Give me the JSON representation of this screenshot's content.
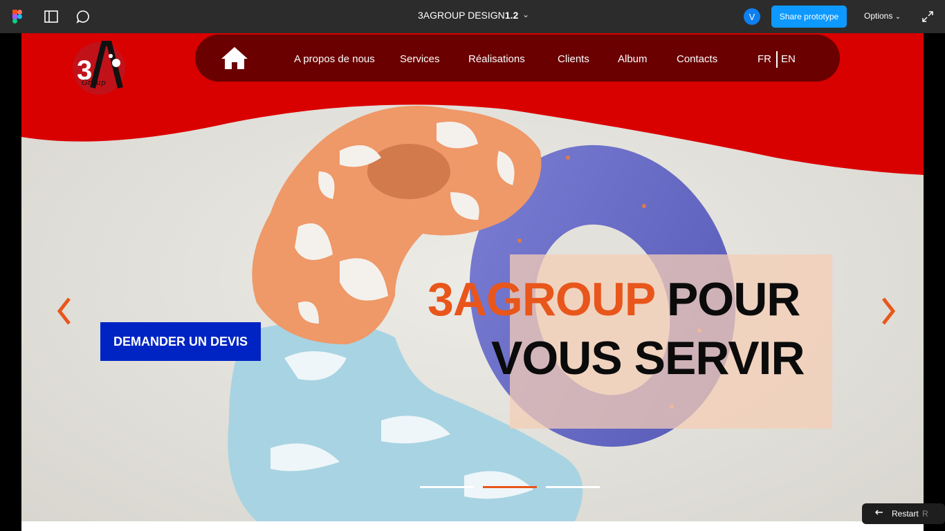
{
  "topbar": {
    "title_prefix": "3AGROUP DESIGN",
    "title_version": "1.2",
    "avatar_initial": "V",
    "share_label": "Share prototype",
    "options_label": "Options"
  },
  "site": {
    "logo_alt": "3A Group",
    "nav": {
      "items": [
        "A propos de nous",
        "Services",
        "Réalisations",
        "Clients",
        "Album",
        "Contacts"
      ],
      "lang_fr": "FR",
      "lang_en": "EN"
    },
    "hero": {
      "accent": "3AGROUP",
      "line1_rest": " POUR",
      "line2": "VOUS SERVIR",
      "cta": "DEMANDER UN DEVIS"
    },
    "slider": {
      "count": 3,
      "active_index": 1
    }
  },
  "overlay": {
    "restart_label": "Restart",
    "restart_key": "R"
  },
  "colors": {
    "brand_red": "#d90000",
    "nav_dark": "#6a0000",
    "accent_orange": "#e8561b",
    "cta_blue": "#0024c4",
    "figma_blue": "#0d99ff"
  }
}
